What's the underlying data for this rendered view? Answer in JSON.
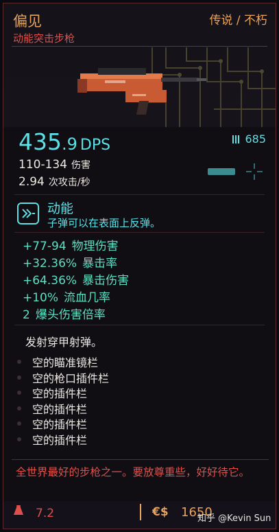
{
  "header": {
    "name": "偏见",
    "type": "动能突击步枪",
    "rarity": "传说 / 不朽"
  },
  "stats": {
    "dps_int": "435",
    "dps_frac": ".9",
    "dps_unit": "DPS",
    "ammo": "685",
    "damage_value": "110-134",
    "damage_label": "伤害",
    "rate_value": "2.94",
    "rate_label": "次攻击/秒"
  },
  "tech": {
    "title": "动能",
    "description": "子弹可以在表面上反弹。"
  },
  "bonuses": [
    {
      "value": "+77-94",
      "name": "物理伤害"
    },
    {
      "value": "+32.36%",
      "name": "暴击率"
    },
    {
      "value": "+64.36%",
      "name": "暴击伤害"
    },
    {
      "value": "+10%",
      "name": "流血几率"
    },
    {
      "value": "2",
      "name": "爆头伤害倍率"
    }
  ],
  "armor_text": "发射穿甲射弹。",
  "slots": [
    "空的瞄准镜栏",
    "空的枪口插件栏",
    "空的插件栏",
    "空的插件栏",
    "空的插件栏",
    "空的插件栏"
  ],
  "flavor_text": "全世界最好的步枪之一。要放尊重些，好好待它。",
  "footer": {
    "weight": "7.2",
    "money_symbol": "€$",
    "price": "1650",
    "watermark": "知乎 @Kevin Sun"
  },
  "icons": {
    "ammo": "ammo-icon",
    "tech": "tech-icon",
    "weight": "weight-icon",
    "reticle": "reticle-icon",
    "money": "eddies-icon"
  },
  "colors": {
    "accent_cyan": "#5ce1e6",
    "legendary_orange": "#e8a35a",
    "red": "#e0504a",
    "bonus_green": "#5ee0c4"
  }
}
